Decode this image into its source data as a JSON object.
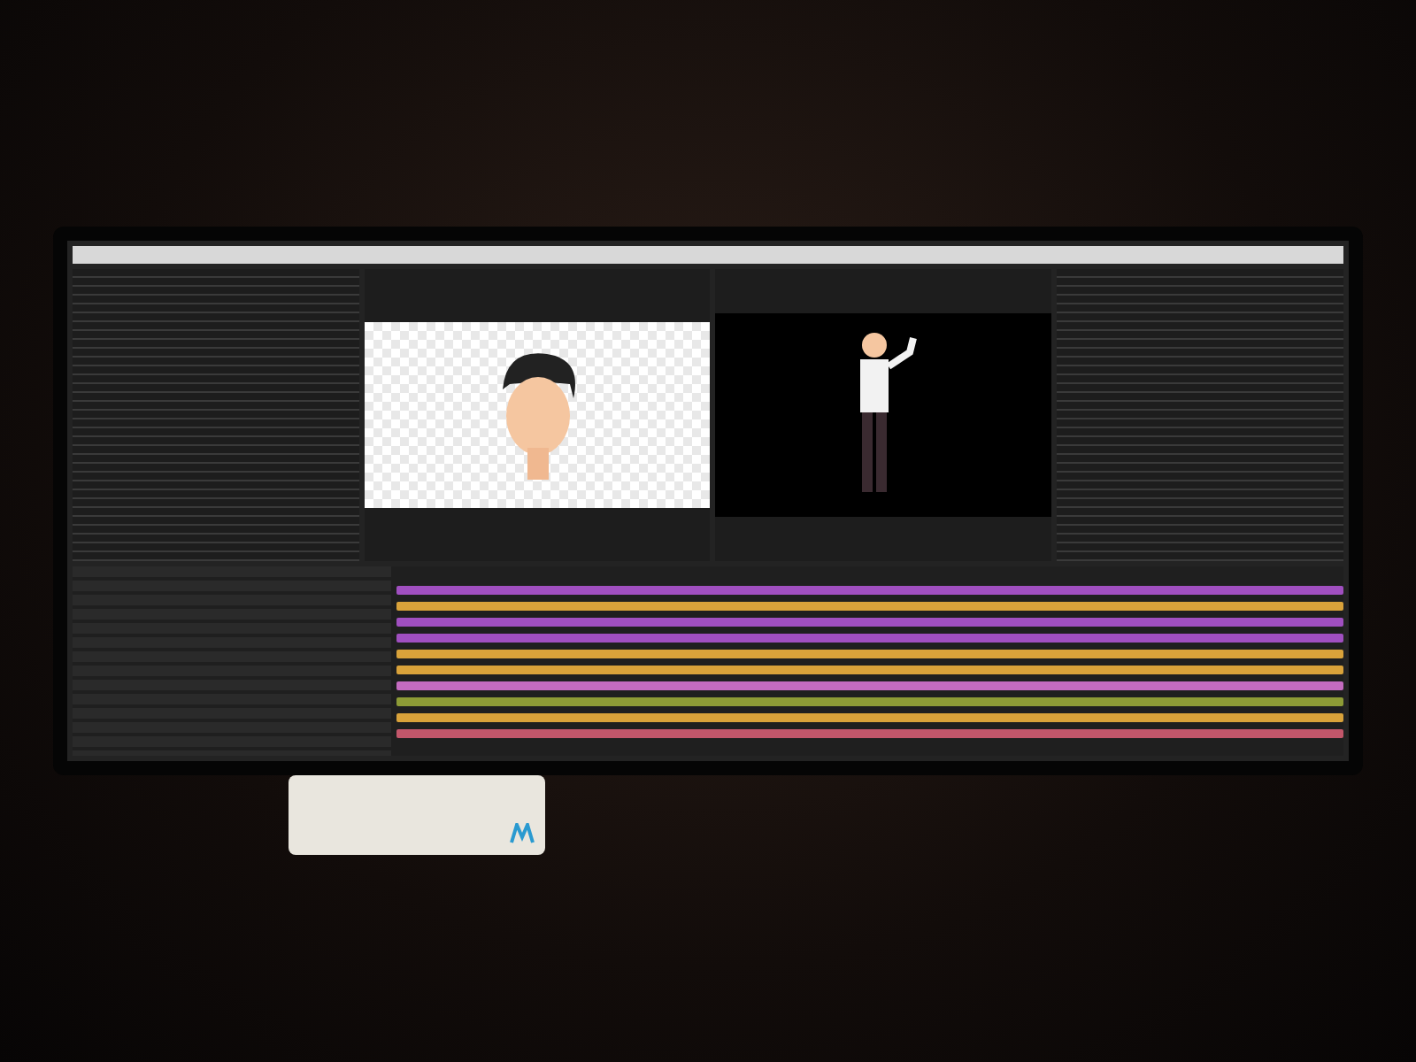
{
  "timeline": {
    "layer_bars": [
      {
        "color": "#a04fc0"
      },
      {
        "color": "#d9a23a"
      },
      {
        "color": "#a04fc0"
      },
      {
        "color": "#a04fc0"
      },
      {
        "color": "#d9a23a"
      },
      {
        "color": "#d9a23a"
      },
      {
        "color": "#c46bc0"
      },
      {
        "color": "#8d9b36"
      },
      {
        "color": "#d9a23a"
      },
      {
        "color": "#c2566a"
      }
    ]
  }
}
